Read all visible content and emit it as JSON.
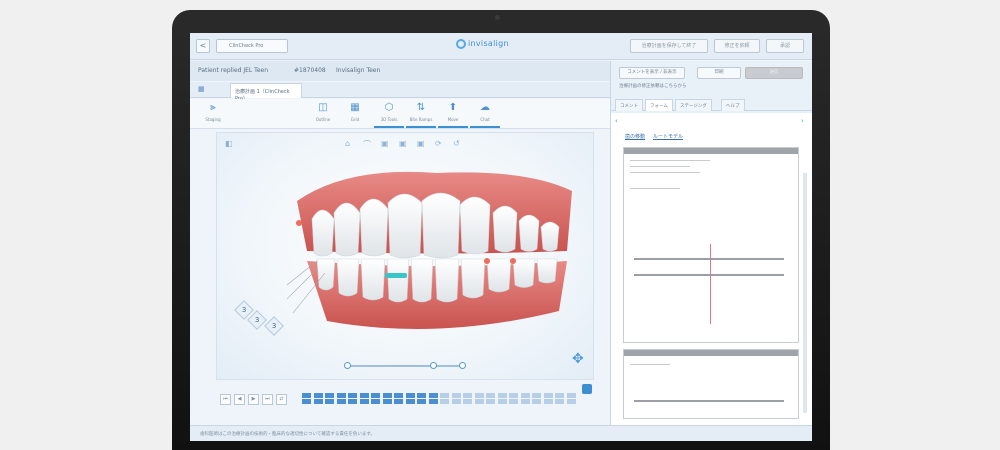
{
  "topbar": {
    "back_label": "<",
    "case_select": "ClinCheck Pro",
    "logo": "invisalign",
    "buttons": [
      "治療計画を保存して終了",
      "修正を依頼",
      "承認"
    ]
  },
  "patient": {
    "name": "Patient replied JEL Teen",
    "id": "#1870408",
    "type": "Invisalign Teen"
  },
  "tabs": {
    "home_icon": "grid-icon",
    "active": "治療計画 1（ClinCheck Pro）"
  },
  "toolbar": {
    "items": [
      {
        "icon": "stack-icon",
        "label": "Staging"
      },
      {
        "icon": "tooth-icon",
        "label": "Outline"
      },
      {
        "icon": "grid-icon",
        "label": "Grid"
      },
      {
        "icon": "tooth-icon",
        "label": "3D Tools"
      },
      {
        "icon": "arrows-icon",
        "label": "Bite Ramps"
      },
      {
        "icon": "move-icon",
        "label": "Move"
      },
      {
        "icon": "chat-icon",
        "label": "Chat"
      }
    ]
  },
  "viewport": {
    "top_icons": [
      "⌂",
      "⌒",
      "▣",
      "▣",
      "▣",
      "⟳",
      "↺"
    ],
    "labels": [
      "3",
      "3",
      "3"
    ]
  },
  "timeline": {
    "controls": [
      "⏮",
      "◀",
      "▶",
      "⏭",
      "⇄"
    ]
  },
  "statusbar": {
    "text": "歯科医師はこの治療計画の技術的・臨床的な適切性について確認する責任を負います。"
  },
  "rpanel": {
    "buttons": [
      "コメントを表示 / 非表示",
      "印刷",
      "送信"
    ],
    "note": "治療計画の修正依頼はこちらから",
    "tabs": [
      "コメント",
      "フォーム",
      "ステージング",
      "ヘルプ"
    ],
    "links": [
      "歯の移動",
      "ルートモデル"
    ]
  }
}
